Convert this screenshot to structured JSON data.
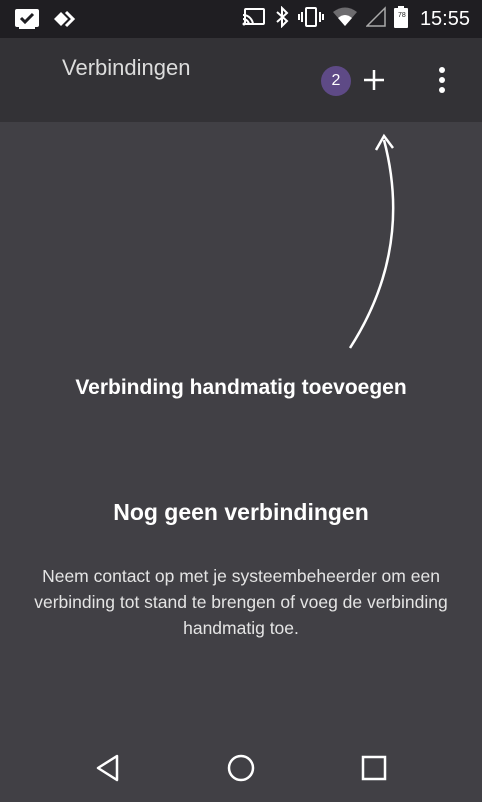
{
  "status_bar": {
    "time": "15:55",
    "battery_level": "78",
    "icons": [
      "notification-check-icon",
      "notification-diamond-icon",
      "cast-icon",
      "bluetooth-icon",
      "vibrate-icon",
      "wifi-icon",
      "cell-signal-icon",
      "battery-icon"
    ]
  },
  "app_bar": {
    "title": "Verbindingen",
    "badge_count": "2",
    "add_icon": "plus-icon",
    "menu_icon": "more-vert-icon"
  },
  "hint": {
    "label": "Verbinding handmatig toevoegen"
  },
  "empty_state": {
    "title": "Nog geen verbindingen",
    "description": "Neem contact op met je systeembeheerder om een verbinding tot stand te brengen of voeg de verbinding handmatig toe."
  },
  "nav_bar": {
    "icons": [
      "back-icon",
      "home-icon",
      "recents-icon"
    ]
  },
  "colors": {
    "background": "#414045",
    "app_bar": "#333236",
    "status_bar": "#1f1e22",
    "badge": "#5e4a86"
  }
}
